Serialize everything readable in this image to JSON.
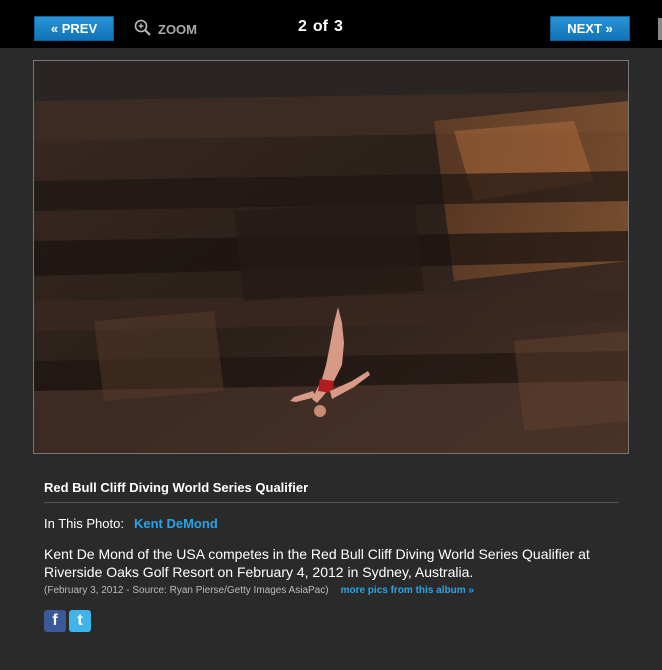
{
  "nav": {
    "prev_label": "« PREV",
    "zoom_label": "ZOOM",
    "next_label": "NEXT »",
    "counter": {
      "current": "2",
      "of": "of",
      "total": "3"
    }
  },
  "photo": {
    "title": "Red Bull Cliff Diving World Series Qualifier",
    "in_this_photo_label": "In This Photo:",
    "person": "Kent DeMond",
    "description": "Kent De Mond of the USA competes in the Red Bull Cliff Diving World Series Qualifier at Riverside Oaks Golf Resort on February 4, 2012 in Sydney, Australia.",
    "source": "(February 3, 2012 - Source: Ryan Pierse/Getty Images AsiaPac)",
    "more_link": "more pics from this album »"
  },
  "social": {
    "facebook": "f",
    "twitter": "t"
  },
  "colors": {
    "accent": "#2aa3e6",
    "button": "#1a85c9",
    "background": "#2a2a2a"
  }
}
